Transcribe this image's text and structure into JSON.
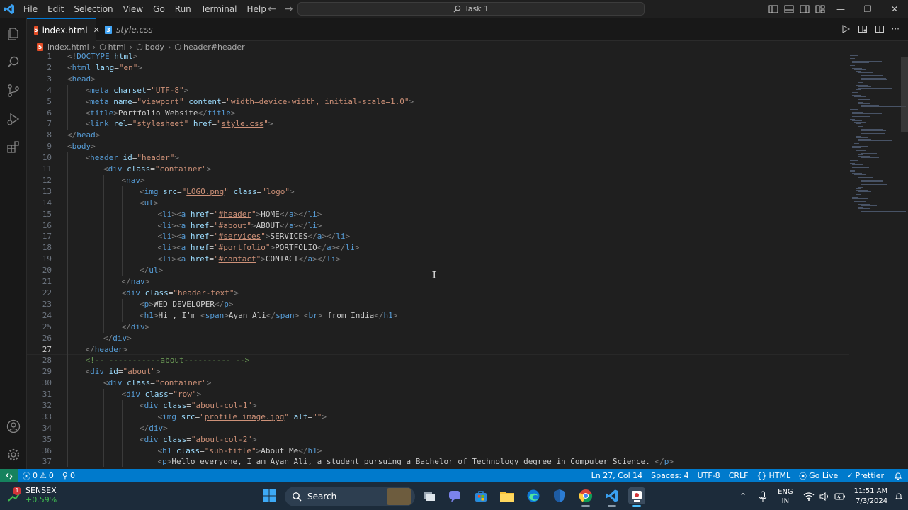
{
  "titlebar": {
    "menus": [
      "File",
      "Edit",
      "Selection",
      "View",
      "Go",
      "Run",
      "Terminal",
      "Help"
    ],
    "search_text": "Task 1"
  },
  "tabs": [
    {
      "label": "index.html",
      "active": true,
      "icon": "html-file-icon"
    },
    {
      "label": "style.css",
      "active": false,
      "icon": "css-file-icon"
    }
  ],
  "breadcrumb": [
    "index.html",
    "html",
    "body",
    "header#header"
  ],
  "editor": {
    "current_line": 27,
    "lines": [
      {
        "n": "1",
        "ind": 0,
        "h": "<span class=\"p\">&lt;!</span><span class=\"t\">DOCTYPE</span> <span class=\"a\">html</span><span class=\"p\">&gt;</span>"
      },
      {
        "n": "2",
        "ind": 0,
        "h": "<span class=\"p\">&lt;</span><span class=\"t\">html</span> <span class=\"a\">lang</span>=<span class=\"s\">\"en\"</span><span class=\"p\">&gt;</span>"
      },
      {
        "n": "3",
        "ind": 0,
        "h": "<span class=\"p\">&lt;</span><span class=\"t\">head</span><span class=\"p\">&gt;</span>"
      },
      {
        "n": "4",
        "ind": 1,
        "h": "<span class=\"p\">&lt;</span><span class=\"t\">meta</span> <span class=\"a\">charset</span>=<span class=\"s\">\"UTF-8\"</span><span class=\"p\">&gt;</span>"
      },
      {
        "n": "5",
        "ind": 1,
        "h": "<span class=\"p\">&lt;</span><span class=\"t\">meta</span> <span class=\"a\">name</span>=<span class=\"s\">\"viewport\"</span> <span class=\"a\">content</span>=<span class=\"s\">\"width=device-width, initial-scale=1.0\"</span><span class=\"p\">&gt;</span>"
      },
      {
        "n": "6",
        "ind": 1,
        "h": "<span class=\"p\">&lt;</span><span class=\"t\">title</span><span class=\"p\">&gt;</span>Portfolio Website<span class=\"p\">&lt;/</span><span class=\"t\">title</span><span class=\"p\">&gt;</span>"
      },
      {
        "n": "7",
        "ind": 1,
        "h": "<span class=\"p\">&lt;</span><span class=\"t\">link</span> <span class=\"a\">rel</span>=<span class=\"s\">\"stylesheet\"</span> <span class=\"a\">href</span>=<span class=\"s\">\"</span><span class=\"u\">style.css</span><span class=\"s\">\"</span><span class=\"p\">&gt;</span>"
      },
      {
        "n": "8",
        "ind": 0,
        "h": "<span class=\"p\">&lt;/</span><span class=\"t\">head</span><span class=\"p\">&gt;</span>"
      },
      {
        "n": "9",
        "ind": 0,
        "h": "<span class=\"p\">&lt;</span><span class=\"t\">body</span><span class=\"p\">&gt;</span>"
      },
      {
        "n": "10",
        "ind": 1,
        "h": "<span class=\"p\">&lt;</span><span class=\"t\">header</span> <span class=\"a\">id</span>=<span class=\"s\">\"header\"</span><span class=\"p\">&gt;</span>"
      },
      {
        "n": "11",
        "ind": 2,
        "h": "<span class=\"p\">&lt;</span><span class=\"t\">div</span> <span class=\"a\">class</span>=<span class=\"s\">\"container\"</span><span class=\"p\">&gt;</span>"
      },
      {
        "n": "12",
        "ind": 3,
        "h": "<span class=\"p\">&lt;</span><span class=\"t\">nav</span><span class=\"p\">&gt;</span>"
      },
      {
        "n": "13",
        "ind": 4,
        "h": "<span class=\"p\">&lt;</span><span class=\"t\">img</span> <span class=\"a\">src</span>=<span class=\"s\">\"</span><span class=\"u\">LOGO.png</span><span class=\"s\">\"</span> <span class=\"a\">class</span>=<span class=\"s\">\"logo\"</span><span class=\"p\">&gt;</span>"
      },
      {
        "n": "14",
        "ind": 4,
        "h": "<span class=\"p\">&lt;</span><span class=\"t\">ul</span><span class=\"p\">&gt;</span>"
      },
      {
        "n": "15",
        "ind": 5,
        "h": "<span class=\"p\">&lt;</span><span class=\"t\">li</span><span class=\"p\">&gt;&lt;</span><span class=\"t\">a</span> <span class=\"a\">href</span>=<span class=\"s\">\"</span><span class=\"u\">#header</span><span class=\"s\">\"</span><span class=\"p\">&gt;</span>HOME<span class=\"p\">&lt;/</span><span class=\"t\">a</span><span class=\"p\">&gt;&lt;/</span><span class=\"t\">li</span><span class=\"p\">&gt;</span>"
      },
      {
        "n": "16",
        "ind": 5,
        "h": "<span class=\"p\">&lt;</span><span class=\"t\">li</span><span class=\"p\">&gt;&lt;</span><span class=\"t\">a</span> <span class=\"a\">href</span>=<span class=\"s\">\"</span><span class=\"u\">#about</span><span class=\"s\">\"</span><span class=\"p\">&gt;</span>ABOUT<span class=\"p\">&lt;/</span><span class=\"t\">a</span><span class=\"p\">&gt;&lt;/</span><span class=\"t\">li</span><span class=\"p\">&gt;</span>"
      },
      {
        "n": "17",
        "ind": 5,
        "h": "<span class=\"p\">&lt;</span><span class=\"t\">li</span><span class=\"p\">&gt;&lt;</span><span class=\"t\">a</span> <span class=\"a\">href</span>=<span class=\"s\">\"</span><span class=\"u\">#services</span><span class=\"s\">\"</span><span class=\"p\">&gt;</span>SERVICES<span class=\"p\">&lt;/</span><span class=\"t\">a</span><span class=\"p\">&gt;&lt;/</span><span class=\"t\">li</span><span class=\"p\">&gt;</span>"
      },
      {
        "n": "18",
        "ind": 5,
        "h": "<span class=\"p\">&lt;</span><span class=\"t\">li</span><span class=\"p\">&gt;&lt;</span><span class=\"t\">a</span> <span class=\"a\">href</span>=<span class=\"s\">\"</span><span class=\"u\">#portfolio</span><span class=\"s\">\"</span><span class=\"p\">&gt;</span>PORTFOLIO<span class=\"p\">&lt;/</span><span class=\"t\">a</span><span class=\"p\">&gt;&lt;/</span><span class=\"t\">li</span><span class=\"p\">&gt;</span>"
      },
      {
        "n": "19",
        "ind": 5,
        "h": "<span class=\"p\">&lt;</span><span class=\"t\">li</span><span class=\"p\">&gt;&lt;</span><span class=\"t\">a</span> <span class=\"a\">href</span>=<span class=\"s\">\"</span><span class=\"u\">#contact</span><span class=\"s\">\"</span><span class=\"p\">&gt;</span>CONTACT<span class=\"p\">&lt;/</span><span class=\"t\">a</span><span class=\"p\">&gt;&lt;/</span><span class=\"t\">li</span><span class=\"p\">&gt;</span>"
      },
      {
        "n": "20",
        "ind": 4,
        "h": "<span class=\"p\">&lt;/</span><span class=\"t\">ul</span><span class=\"p\">&gt;</span>"
      },
      {
        "n": "21",
        "ind": 3,
        "h": "<span class=\"p\">&lt;/</span><span class=\"t\">nav</span><span class=\"p\">&gt;</span>"
      },
      {
        "n": "22",
        "ind": 3,
        "h": "<span class=\"p\">&lt;</span><span class=\"t\">div</span> <span class=\"a\">class</span>=<span class=\"s\">\"header-text\"</span><span class=\"p\">&gt;</span>"
      },
      {
        "n": "23",
        "ind": 4,
        "h": "<span class=\"p\">&lt;</span><span class=\"t\">p</span><span class=\"p\">&gt;</span>WED DEVELOPER<span class=\"p\">&lt;/</span><span class=\"t\">p</span><span class=\"p\">&gt;</span>"
      },
      {
        "n": "24",
        "ind": 4,
        "h": "<span class=\"p\">&lt;</span><span class=\"t\">h1</span><span class=\"p\">&gt;</span>Hi , I'm <span class=\"p\">&lt;</span><span class=\"t\">span</span><span class=\"p\">&gt;</span>Ayan Ali<span class=\"p\">&lt;/</span><span class=\"t\">span</span><span class=\"p\">&gt;</span> <span class=\"p\">&lt;</span><span class=\"t\">br</span><span class=\"p\">&gt;</span> from India<span class=\"p\">&lt;/</span><span class=\"t\">h1</span><span class=\"p\">&gt;</span>"
      },
      {
        "n": "25",
        "ind": 3,
        "h": "<span class=\"p\">&lt;/</span><span class=\"t\">div</span><span class=\"p\">&gt;</span>"
      },
      {
        "n": "26",
        "ind": 2,
        "h": "<span class=\"p\">&lt;/</span><span class=\"t\">div</span><span class=\"p\">&gt;</span>"
      },
      {
        "n": "27",
        "ind": 1,
        "h": "<span class=\"p\">&lt;/</span><span class=\"t\">header</span><span class=\"p\">&gt;</span>"
      },
      {
        "n": "28",
        "ind": 1,
        "h": "<span class=\"c\">&lt;!-- -----------about---------- --&gt;</span>"
      },
      {
        "n": "29",
        "ind": 1,
        "h": "<span class=\"p\">&lt;</span><span class=\"t\">div</span> <span class=\"a\">id</span>=<span class=\"s\">\"about\"</span><span class=\"p\">&gt;</span>"
      },
      {
        "n": "30",
        "ind": 2,
        "h": "<span class=\"p\">&lt;</span><span class=\"t\">div</span> <span class=\"a\">class</span>=<span class=\"s\">\"container\"</span><span class=\"p\">&gt;</span>"
      },
      {
        "n": "31",
        "ind": 3,
        "h": "<span class=\"p\">&lt;</span><span class=\"t\">div</span> <span class=\"a\">class</span>=<span class=\"s\">\"row\"</span><span class=\"p\">&gt;</span>"
      },
      {
        "n": "32",
        "ind": 4,
        "h": "<span class=\"p\">&lt;</span><span class=\"t\">div</span> <span class=\"a\">class</span>=<span class=\"s\">\"about-col-1\"</span><span class=\"p\">&gt;</span>"
      },
      {
        "n": "33",
        "ind": 5,
        "h": "<span class=\"p\">&lt;</span><span class=\"t\">img</span> <span class=\"a\">src</span>=<span class=\"s\">\"</span><span class=\"u\">profile image.jpg</span><span class=\"s\">\"</span> <span class=\"a\">alt</span>=<span class=\"s\">\"\"</span><span class=\"p\">&gt;</span>"
      },
      {
        "n": "34",
        "ind": 4,
        "h": "<span class=\"p\">&lt;/</span><span class=\"t\">div</span><span class=\"p\">&gt;</span>"
      },
      {
        "n": "35",
        "ind": 4,
        "h": "<span class=\"p\">&lt;</span><span class=\"t\">div</span> <span class=\"a\">class</span>=<span class=\"s\">\"about-col-2\"</span><span class=\"p\">&gt;</span>"
      },
      {
        "n": "36",
        "ind": 5,
        "h": "<span class=\"p\">&lt;</span><span class=\"t\">h1</span> <span class=\"a\">class</span>=<span class=\"s\">\"sub-title\"</span><span class=\"p\">&gt;</span>About Me<span class=\"p\">&lt;/</span><span class=\"t\">h1</span><span class=\"p\">&gt;</span>"
      },
      {
        "n": "37",
        "ind": 5,
        "h": "<span class=\"p\">&lt;</span><span class=\"t\">p</span><span class=\"p\">&gt;</span>Hello everyone, I am Ayan Ali, a student pursuing a Bachelor of Technology degree in Computer Science. <span class=\"p\">&lt;/</span><span class=\"t\">p</span><span class=\"p\">&gt;</span>"
      }
    ]
  },
  "statusbar": {
    "errors": "0",
    "warnings": "0",
    "ports": "0",
    "position": "Ln 27, Col 14",
    "spaces": "Spaces: 4",
    "encoding": "UTF-8",
    "eol": "CRLF",
    "language": "HTML",
    "go_live": "Go Live",
    "prettier": "Prettier"
  },
  "taskbar": {
    "widget_name": "SENSEX",
    "widget_value": "+0.59%",
    "widget_badge": "1",
    "search_label": "Search",
    "lang_line1": "ENG",
    "lang_line2": "IN",
    "time": "11:51 AM",
    "date": "7/3/2024"
  },
  "colors": {
    "accent": "#0078d4",
    "statusbar": "#007acc",
    "remote": "#16825d",
    "html_icon": "#e44d26",
    "css_icon": "#42a5f5"
  }
}
